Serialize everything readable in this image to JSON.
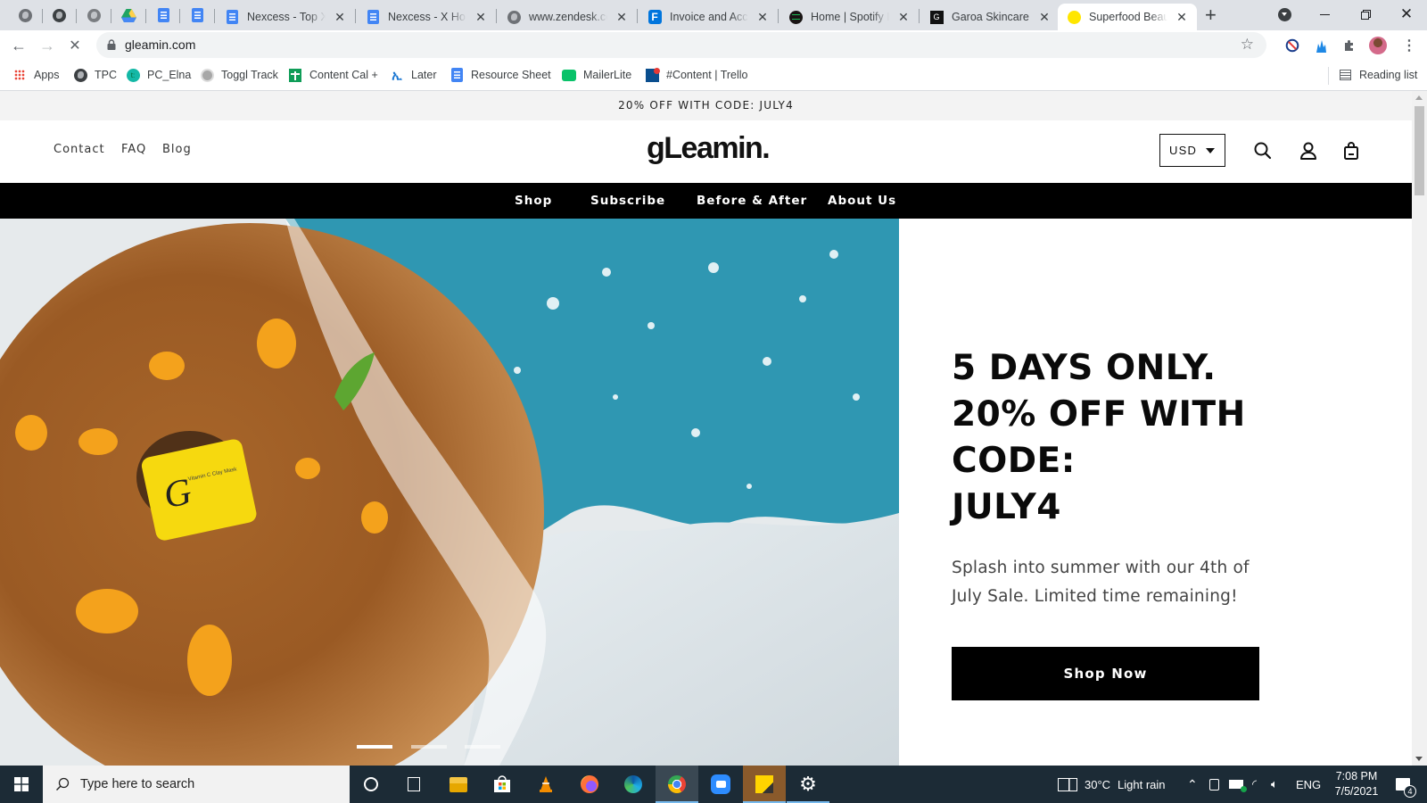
{
  "browser": {
    "pinned_tabs": [
      {
        "icon": "globe-icon"
      },
      {
        "icon": "globe-icon"
      },
      {
        "icon": "globe-icon"
      },
      {
        "icon": "google-drive-icon"
      },
      {
        "icon": "google-docs-icon"
      },
      {
        "icon": "google-docs-icon"
      }
    ],
    "tabs": [
      {
        "title": "Nexcess - Top X Ecommerce",
        "icon": "google-docs-icon",
        "active": false
      },
      {
        "title": "Nexcess - X Homepage",
        "icon": "google-docs-icon",
        "active": false
      },
      {
        "title": "www.zendesk.com",
        "icon": "globe-icon",
        "active": false
      },
      {
        "title": "Invoice and Accounting",
        "icon": "freshbooks-icon",
        "active": false
      },
      {
        "title": "Home | Spotify Dashboard",
        "icon": "spotify-icon",
        "active": false
      },
      {
        "title": "Garoa Skincare",
        "icon": "garoa-icon",
        "active": false
      },
      {
        "title": "Superfood Beauty",
        "icon": "gleamin-favicon",
        "active": true
      }
    ],
    "new_tab_label": "+",
    "url": "gleamin.com",
    "bookmarks": [
      {
        "label": "Apps",
        "icon": "apps-grid-icon"
      },
      {
        "label": "TPC",
        "icon": "globe-icon"
      },
      {
        "label": "PC_Elna",
        "icon": "teal-t-icon"
      },
      {
        "label": "Toggl Track",
        "icon": "toggl-icon"
      },
      {
        "label": "Content Cal +",
        "icon": "google-sheets-icon"
      },
      {
        "label": "Later",
        "icon": "later-icon"
      },
      {
        "label": "Resource Sheet",
        "icon": "google-docs-icon"
      },
      {
        "label": "MailerLite",
        "icon": "mailerlite-icon"
      },
      {
        "label": "#Content | Trello",
        "icon": "trello-icon"
      }
    ],
    "reading_list_label": "Reading list"
  },
  "site": {
    "promo_bar": "20% OFF WITH CODE: JULY4",
    "utility_links": [
      "Contact",
      "FAQ",
      "Blog"
    ],
    "logo": "gLeamin.",
    "currency": "USD",
    "main_nav": [
      "Shop",
      "Subscribe",
      "Before & After",
      "About Us"
    ],
    "hero": {
      "title_lines": [
        "5 DAYS ONLY.",
        "20% OFF WITH CODE:",
        "JULY4"
      ],
      "subtitle": "Splash into summer with our 4th of July Sale. Limited time remaining!",
      "cta_label": "Shop Now",
      "jar_label": "Vitamin C Clay Mask",
      "slides_total": 3,
      "active_slide": 1
    }
  },
  "taskbar": {
    "search_placeholder": "Type here to search",
    "apps": [
      "cortana",
      "task-view",
      "file-explorer",
      "microsoft-store",
      "vlc",
      "firefox",
      "edge",
      "chrome",
      "zoom",
      "sticky-notes",
      "settings"
    ],
    "weather_temp": "30°C",
    "weather_desc": "Light rain",
    "language": "ENG",
    "time": "7:08 PM",
    "date": "7/5/2021",
    "notification_count": "4"
  },
  "colors": {
    "brand_black": "#000000",
    "promo_bg": "#f3f3f3",
    "taskbar_bg": "#1c2b36",
    "chrome_tabstrip": "#dee1e6"
  }
}
